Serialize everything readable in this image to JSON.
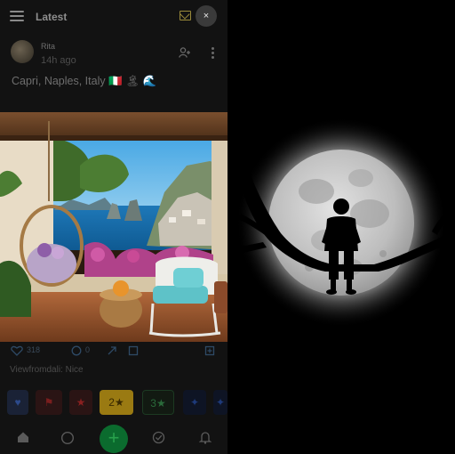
{
  "header": {
    "title": "Latest",
    "close_label": "×"
  },
  "post": {
    "author": "Rita",
    "time": "14h ago",
    "caption": "Capri, Naples, Italy 🇮🇹 🏝 🌊",
    "actions": {
      "likes": "318",
      "comments": "0"
    },
    "views_line": "Viewfromdali: Nice"
  },
  "chips": [
    {
      "label": ""
    },
    {
      "label": ""
    },
    {
      "label": ""
    },
    {
      "label": "2★"
    },
    {
      "label": "3★"
    },
    {
      "label": ""
    },
    {
      "label": ""
    }
  ],
  "icons": [
    "menu-icon",
    "mail-icon",
    "close-icon",
    "follow-user-icon",
    "more-vert-icon",
    "heart-icon",
    "comment-icon",
    "share-icon",
    "bookmark-icon",
    "home-icon",
    "circle-icon",
    "add-icon",
    "check-icon",
    "bell-icon"
  ],
  "colors": {
    "fab": "#0b6b2e",
    "moon_glow": "#ffffff"
  }
}
